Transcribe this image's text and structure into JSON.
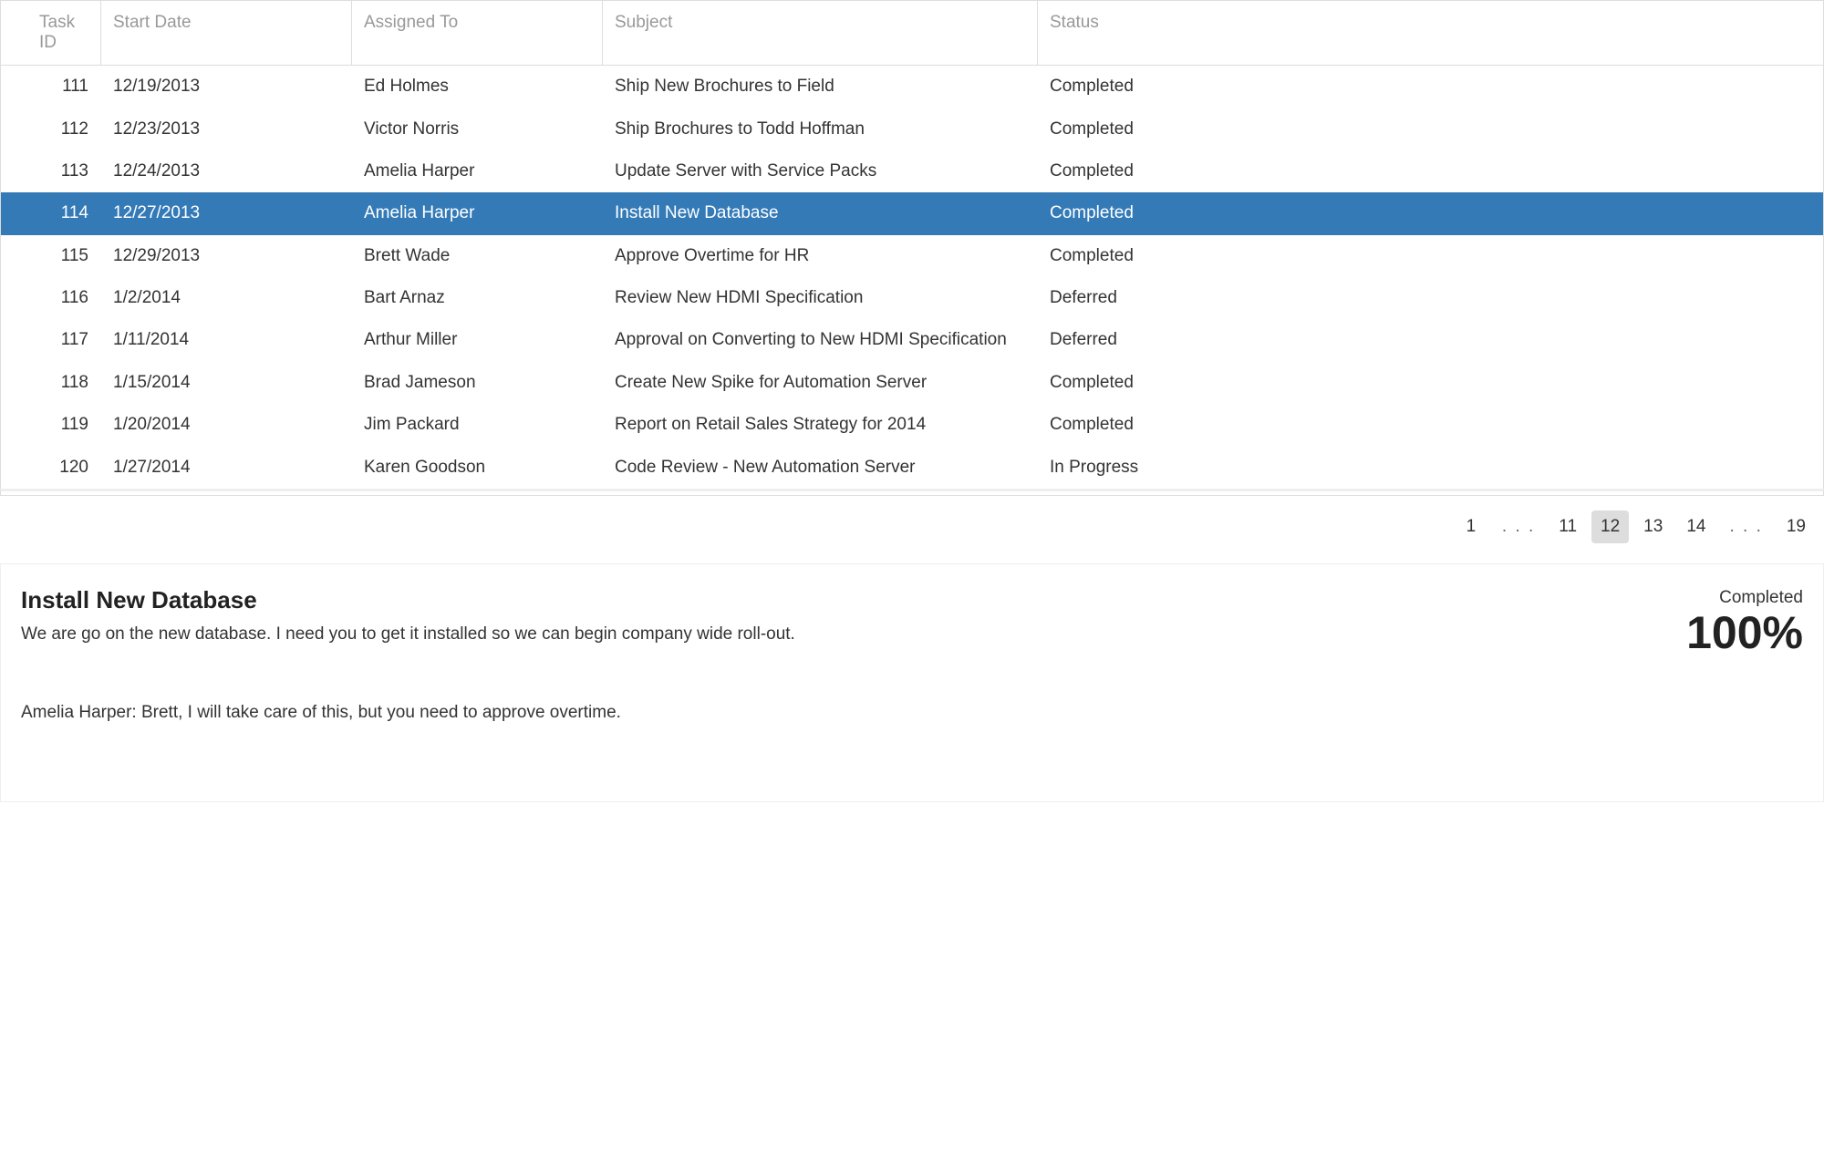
{
  "table": {
    "columns": {
      "task_id": "Task ID",
      "start_date": "Start Date",
      "assigned_to": "Assigned To",
      "subject": "Subject",
      "status": "Status"
    },
    "rows": [
      {
        "task_id": "111",
        "start_date": "12/19/2013",
        "assigned_to": "Ed Holmes",
        "subject": "Ship New Brochures to Field",
        "status": "Completed",
        "selected": false
      },
      {
        "task_id": "112",
        "start_date": "12/23/2013",
        "assigned_to": "Victor Norris",
        "subject": "Ship Brochures to Todd Hoffman",
        "status": "Completed",
        "selected": false
      },
      {
        "task_id": "113",
        "start_date": "12/24/2013",
        "assigned_to": "Amelia Harper",
        "subject": "Update Server with Service Packs",
        "status": "Completed",
        "selected": false
      },
      {
        "task_id": "114",
        "start_date": "12/27/2013",
        "assigned_to": "Amelia Harper",
        "subject": "Install New Database",
        "status": "Completed",
        "selected": true
      },
      {
        "task_id": "115",
        "start_date": "12/29/2013",
        "assigned_to": "Brett Wade",
        "subject": "Approve Overtime for HR",
        "status": "Completed",
        "selected": false
      },
      {
        "task_id": "116",
        "start_date": "1/2/2014",
        "assigned_to": "Bart Arnaz",
        "subject": "Review New HDMI Specification",
        "status": "Deferred",
        "selected": false
      },
      {
        "task_id": "117",
        "start_date": "1/11/2014",
        "assigned_to": "Arthur Miller",
        "subject": "Approval on Converting to New HDMI Specification",
        "status": "Deferred",
        "selected": false
      },
      {
        "task_id": "118",
        "start_date": "1/15/2014",
        "assigned_to": "Brad Jameson",
        "subject": "Create New Spike for Automation Server",
        "status": "Completed",
        "selected": false
      },
      {
        "task_id": "119",
        "start_date": "1/20/2014",
        "assigned_to": "Jim Packard",
        "subject": "Report on Retail Sales Strategy for 2014",
        "status": "Completed",
        "selected": false
      },
      {
        "task_id": "120",
        "start_date": "1/27/2014",
        "assigned_to": "Karen Goodson",
        "subject": "Code Review - New Automation Server",
        "status": "In Progress",
        "selected": false
      }
    ]
  },
  "pager": {
    "pages": [
      {
        "label": "1",
        "type": "page",
        "selected": false
      },
      {
        "label": ". . .",
        "type": "ellipsis",
        "selected": false
      },
      {
        "label": "11",
        "type": "page",
        "selected": false
      },
      {
        "label": "12",
        "type": "page",
        "selected": true
      },
      {
        "label": "13",
        "type": "page",
        "selected": false
      },
      {
        "label": "14",
        "type": "page",
        "selected": false
      },
      {
        "label": ". . .",
        "type": "ellipsis",
        "selected": false
      },
      {
        "label": "19",
        "type": "page",
        "selected": false
      }
    ]
  },
  "detail": {
    "title": "Install New Database",
    "description": "We are go on the new database. I need you to get it installed so we can begin company wide roll-out.",
    "notes": "Amelia Harper: Brett, I will take care of this, but you need to approve overtime.",
    "status": "Completed",
    "progress": "100%"
  }
}
